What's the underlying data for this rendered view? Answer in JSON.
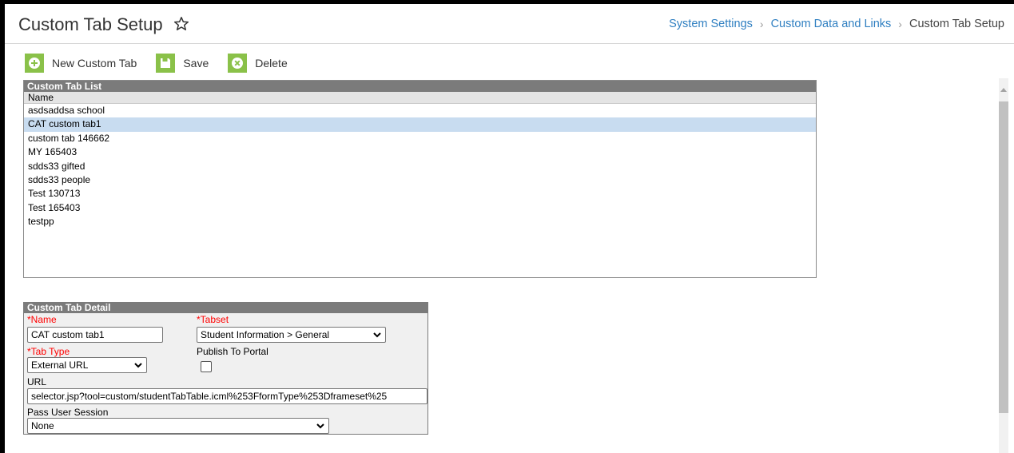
{
  "header": {
    "title": "Custom Tab Setup",
    "breadcrumb": [
      "System Settings",
      "Custom Data and Links",
      "Custom Tab Setup"
    ]
  },
  "toolbar": {
    "new_label": "New Custom Tab",
    "save_label": "Save",
    "delete_label": "Delete"
  },
  "list": {
    "title": "Custom Tab List",
    "column": "Name",
    "items": [
      "asdsaddsa school",
      "CAT custom tab1",
      "custom tab 146662",
      "MY 165403",
      "sdds33 gifted",
      "sdds33 people",
      "Test 130713",
      "Test 165403",
      "testpp"
    ],
    "selected_index": 1
  },
  "detail": {
    "title": "Custom Tab Detail",
    "name_label": "Name",
    "name_value": "CAT custom tab1",
    "tabset_label": "Tabset",
    "tabset_value": "Student Information > General",
    "tabtype_label": "Tab Type",
    "tabtype_value": "External URL",
    "publish_label": "Publish To Portal",
    "publish_checked": false,
    "url_label": "URL",
    "url_value": "selector.jsp?tool=custom/studentTabTable.icml%253FformType%253Dframeset%25",
    "session_label": "Pass User Session",
    "session_value": "None"
  },
  "colors": {
    "accent_green": "#8ac149",
    "link_blue": "#2f7fc1",
    "selected_row": "#c8dcf0",
    "required_red": "#ff0000"
  }
}
